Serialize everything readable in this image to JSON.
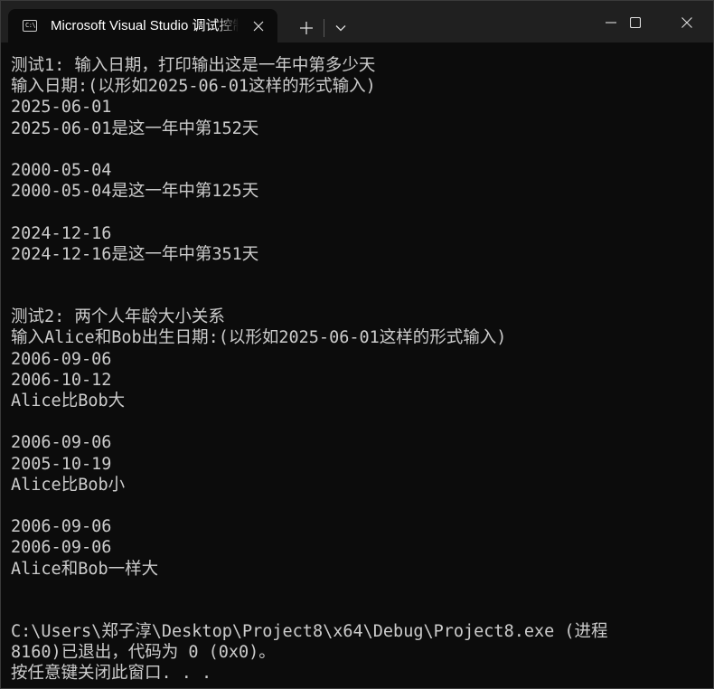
{
  "window": {
    "tab_title": "Microsoft Visual Studio 调试控制台",
    "tab_icon": "terminal-icon",
    "tab_icon_text": "C:\\",
    "close_tab_icon": "close-icon",
    "new_tab_glyph": "+",
    "colors": {
      "titlebar_bg": "#202020",
      "console_bg": "#0c0c0c",
      "console_fg": "#cccccc"
    }
  },
  "console": {
    "lines": [
      "测试1: 输入日期，打印输出这是一年中第多少天",
      "输入日期:(以形如2025-06-01这样的形式输入)",
      "2025-06-01",
      "2025-06-01是这一年中第152天",
      "",
      "2000-05-04",
      "2000-05-04是这一年中第125天",
      "",
      "2024-12-16",
      "2024-12-16是这一年中第351天",
      "",
      "",
      "测试2: 两个人年龄大小关系",
      "输入Alice和Bob出生日期:(以形如2025-06-01这样的形式输入)",
      "2006-09-06",
      "2006-10-12",
      "Alice比Bob大",
      "",
      "2006-09-06",
      "2005-10-19",
      "Alice比Bob小",
      "",
      "2006-09-06",
      "2006-09-06",
      "Alice和Bob一样大",
      "",
      "",
      "C:\\Users\\郑子淳\\Desktop\\Project8\\x64\\Debug\\Project8.exe (进程",
      "8160)已退出，代码为 0 (0x0)。",
      "按任意键关闭此窗口. . ."
    ]
  }
}
